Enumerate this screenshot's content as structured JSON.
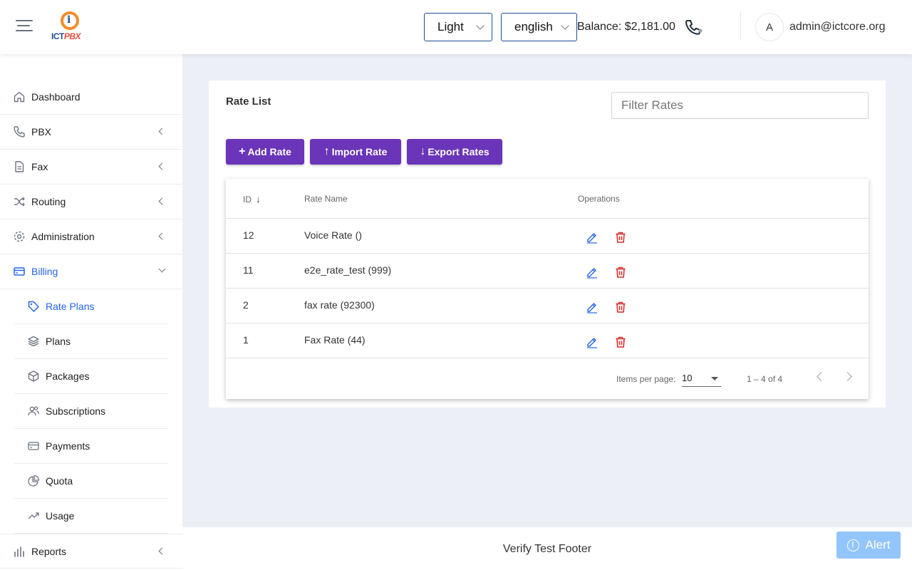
{
  "header": {
    "logo_text_main": "ICT",
    "logo_text_accent": "PBX",
    "logo_letter": "i",
    "theme_value": "Light",
    "language_value": "english",
    "balance": "Balance: $2,181.00",
    "avatar_initial": "A",
    "user_email": "admin@ictcore.org"
  },
  "sidebar": {
    "items": [
      {
        "label": "Dashboard",
        "icon": "home-icon"
      },
      {
        "label": "PBX",
        "icon": "phone-icon"
      },
      {
        "label": "Fax",
        "icon": "document-icon"
      },
      {
        "label": "Routing",
        "icon": "shuffle-icon"
      },
      {
        "label": "Administration",
        "icon": "gear-icon"
      },
      {
        "label": "Billing",
        "icon": "credit-card-icon"
      }
    ],
    "billing_sub": [
      {
        "label": "Rate Plans",
        "icon": "tag-icon"
      },
      {
        "label": "Plans",
        "icon": "layers-icon"
      },
      {
        "label": "Packages",
        "icon": "box-icon"
      },
      {
        "label": "Subscriptions",
        "icon": "users-icon"
      },
      {
        "label": "Payments",
        "icon": "card-icon"
      },
      {
        "label": "Quota",
        "icon": "pie-chart-icon"
      },
      {
        "label": "Usage",
        "icon": "trend-icon"
      }
    ],
    "reports": {
      "label": "Reports",
      "icon": "bar-chart-icon"
    }
  },
  "main": {
    "title": "Rate List",
    "filter_placeholder": "Filter Rates",
    "buttons": {
      "add": "Add Rate",
      "import": "Import Rate",
      "export": "Export Rates"
    },
    "table": {
      "headers": {
        "id": "ID",
        "name": "Rate Name",
        "operations": "Operations"
      },
      "rows": [
        {
          "id": "12",
          "name": "Voice Rate ()"
        },
        {
          "id": "11",
          "name": "e2e_rate_test (999)"
        },
        {
          "id": "2",
          "name": "fax rate (92300)"
        },
        {
          "id": "1",
          "name": "Fax Rate (44)"
        }
      ]
    },
    "pagination": {
      "items_per_page_label": "Items per page:",
      "items_per_page_value": "10",
      "range": "1 – 4 of 4"
    }
  },
  "footer": {
    "text": "Verify Test Footer",
    "alert_label": "Alert"
  },
  "colors": {
    "primary_button": "#6a35b8",
    "active_nav": "#2563eb",
    "edit_icon": "#2563eb",
    "delete_icon": "#dc2626",
    "alert_button": "#93c5fd"
  }
}
